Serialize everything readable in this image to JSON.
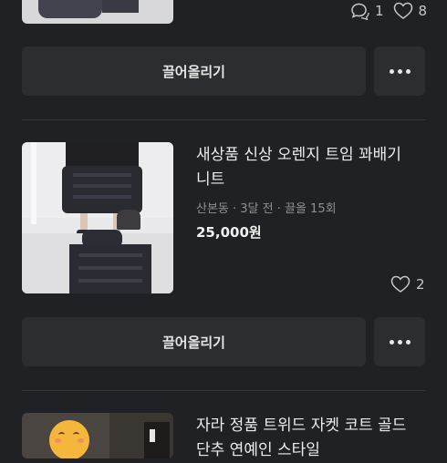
{
  "item_top": {
    "chats": "1",
    "likes": "8"
  },
  "item_1": {
    "title_line1": "새상품 신상 오렌지 트임 꽈배기",
    "title_line2": "니트",
    "meta": "산본동 · 3달 전 · 끌올 15회",
    "price": "25,000원",
    "likes": "2"
  },
  "item_2": {
    "title_line1": "자라 정품 트위드 자켓 코트 골드",
    "title_line2": "단추 연예인 스타일"
  },
  "actions": {
    "bump_label": "끌어올리기"
  },
  "colors": {
    "background": "#202124",
    "button": "#2c2d31",
    "meta_text": "#8e9095"
  }
}
